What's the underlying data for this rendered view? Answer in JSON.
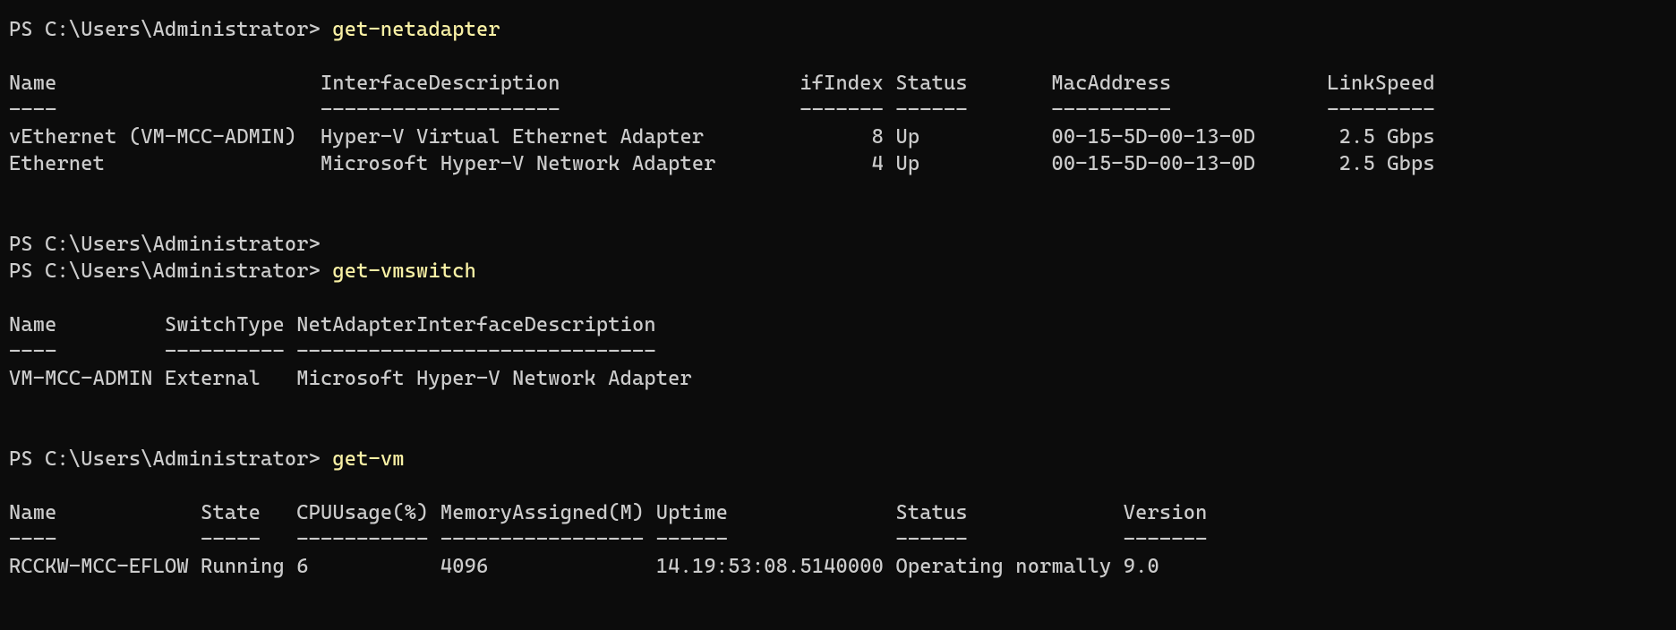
{
  "prompt": "PS C:\\Users\\Administrator>",
  "commands": {
    "cmd1": "get-netadapter",
    "cmd2": "get-vmswitch",
    "cmd3": "get-vm"
  },
  "netadapter": {
    "headers": {
      "name": "Name",
      "ifdesc": "InterfaceDescription",
      "ifindex": "ifIndex",
      "status": "Status",
      "mac": "MacAddress",
      "speed": "LinkSpeed"
    },
    "sep": {
      "name": "----",
      "ifdesc": "--------------------",
      "ifindex": "-------",
      "status": "------",
      "mac": "----------",
      "speed": "---------"
    },
    "rows": [
      {
        "name": "vEthernet (VM-MCC-ADMIN)",
        "ifdesc": "Hyper-V Virtual Ethernet Adapter",
        "ifindex": "8",
        "status": "Up",
        "mac": "00-15-5D-00-13-0D",
        "speed": "2.5 Gbps"
      },
      {
        "name": "Ethernet",
        "ifdesc": "Microsoft Hyper-V Network Adapter",
        "ifindex": "4",
        "status": "Up",
        "mac": "00-15-5D-00-13-0D",
        "speed": "2.5 Gbps"
      }
    ]
  },
  "vmswitch": {
    "headers": {
      "name": "Name",
      "type": "SwitchType",
      "ifdesc": "NetAdapterInterfaceDescription"
    },
    "sep": {
      "name": "----",
      "type": "----------",
      "ifdesc": "------------------------------"
    },
    "rows": [
      {
        "name": "VM-MCC-ADMIN",
        "type": "External",
        "ifdesc": "Microsoft Hyper-V Network Adapter"
      }
    ]
  },
  "vm": {
    "headers": {
      "name": "Name",
      "state": "State",
      "cpu": "CPUUsage(%)",
      "mem": "MemoryAssigned(M)",
      "uptime": "Uptime",
      "status": "Status",
      "version": "Version"
    },
    "sep": {
      "name": "----",
      "state": "-----",
      "cpu": "-----------",
      "mem": "-----------------",
      "uptime": "------",
      "status": "------",
      "version": "-------"
    },
    "rows": [
      {
        "name": "RCCKW-MCC-EFLOW",
        "state": "Running",
        "cpu": "6",
        "mem": "4096",
        "uptime": "14.19:53:08.5140000",
        "status": "Operating normally",
        "version": "9.0"
      }
    ]
  }
}
